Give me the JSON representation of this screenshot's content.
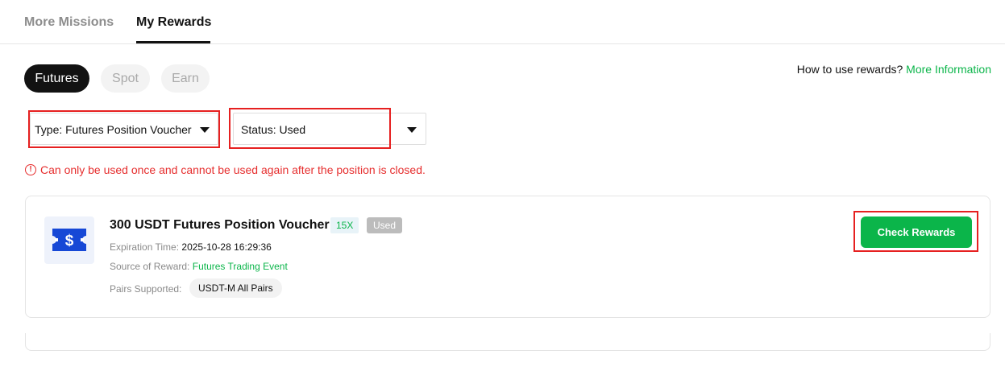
{
  "top_tabs": [
    {
      "label": "More Missions",
      "active": false
    },
    {
      "label": "My Rewards",
      "active": true
    }
  ],
  "categories": [
    {
      "label": "Futures",
      "active": true
    },
    {
      "label": "Spot",
      "active": false
    },
    {
      "label": "Earn",
      "active": false
    }
  ],
  "help": {
    "prefix": "How to use rewards?",
    "link": "More Information"
  },
  "filters": {
    "type": "Type: Futures Position Voucher",
    "status": "Status: Used"
  },
  "warning": "Can only be used once and cannot be used again after the position is closed.",
  "voucher": {
    "icon": "dollar-ticket-icon",
    "title": "300 USDT Futures Position Voucher",
    "leverage": "15X",
    "state": "Used",
    "expiration_label": "Expiration Time:",
    "expiration_value": "2025-10-28 16:29:36",
    "source_label": "Source of Reward:",
    "source_value": "Futures Trading Event",
    "pairs_label": "Pairs Supported:",
    "pairs_value": "USDT-M All Pairs",
    "button": "Check Rewards"
  },
  "colors": {
    "accent": "#0bb54a",
    "warning": "#e62e2e",
    "highlight": "#e62020"
  }
}
